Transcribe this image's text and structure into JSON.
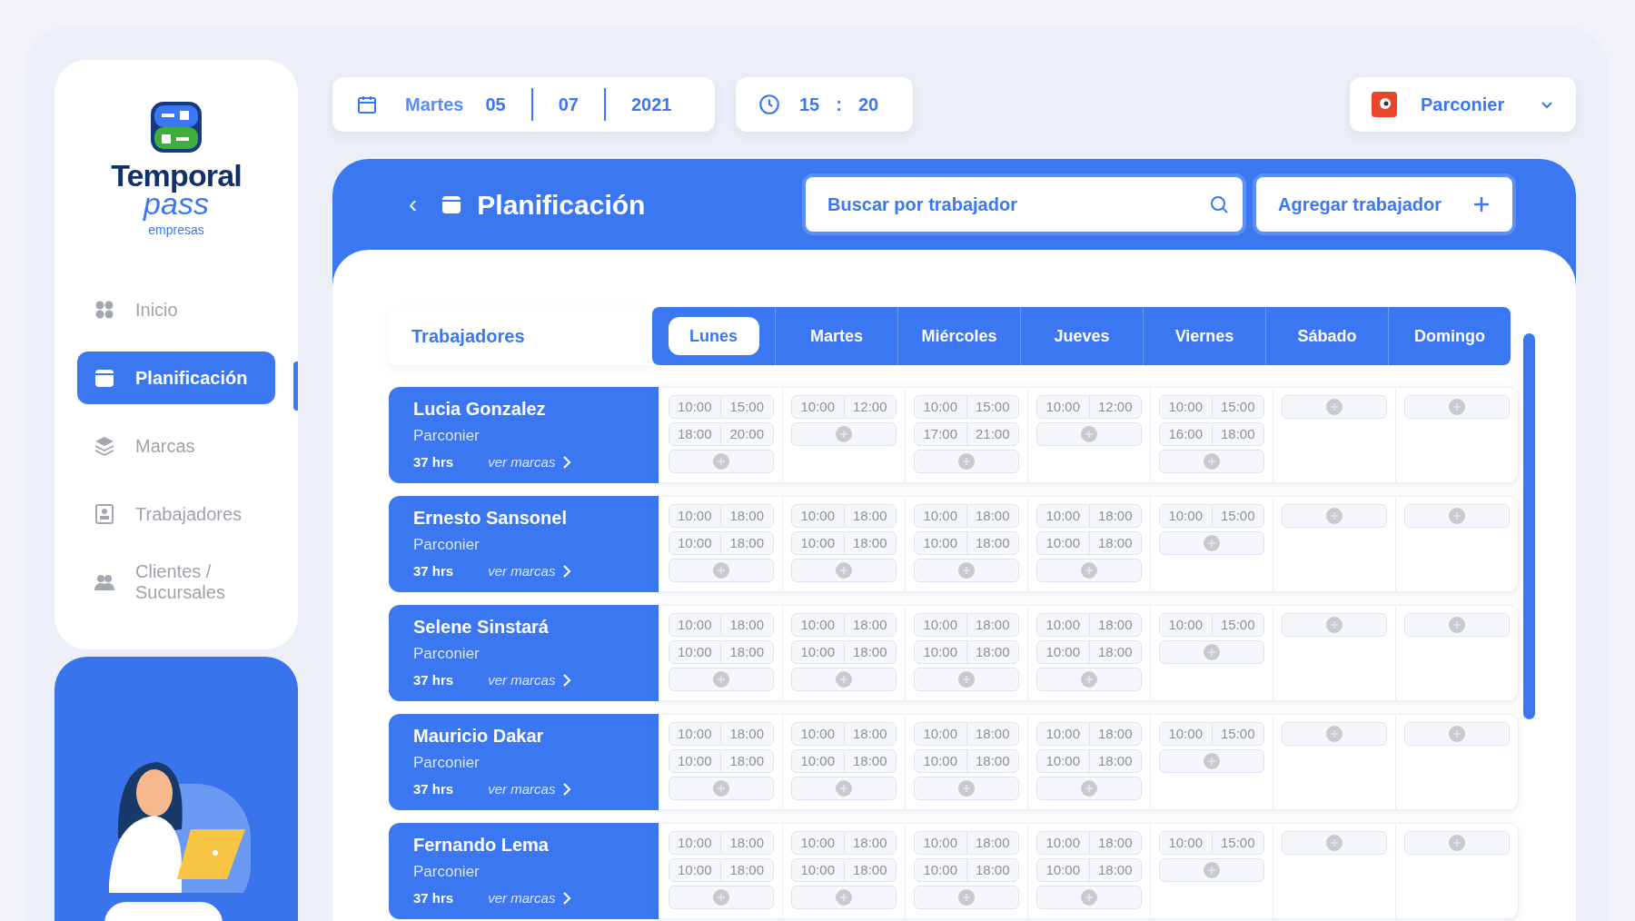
{
  "brand": {
    "name": "Temporal",
    "sub": "pass",
    "tagline": "empresas"
  },
  "sidebar": {
    "items": [
      {
        "label": "Inicio",
        "selected": false
      },
      {
        "label": "Planificación",
        "selected": true
      },
      {
        "label": "Marcas",
        "selected": false
      },
      {
        "label": "Trabajadores",
        "selected": false
      },
      {
        "label": "Clientes / Sucursales",
        "selected": false
      }
    ]
  },
  "date": {
    "weekday": "Martes",
    "day": "05",
    "month": "07",
    "year": "2021"
  },
  "time": {
    "hour": "15",
    "separator": ":",
    "minute": "20"
  },
  "user": {
    "name": "Parconier"
  },
  "header": {
    "back": "‹",
    "title": "Planificación",
    "search": {
      "placeholder": "Buscar por trabajador"
    },
    "add_button": "Agregar trabajador"
  },
  "schedule": {
    "workers_label": "Trabajadores",
    "days": [
      {
        "label": "Lunes",
        "selected": true
      },
      {
        "label": "Martes",
        "selected": false
      },
      {
        "label": "Miércoles",
        "selected": false
      },
      {
        "label": "Jueves",
        "selected": false
      },
      {
        "label": "Viernes",
        "selected": false
      },
      {
        "label": "Sábado",
        "selected": false
      },
      {
        "label": "Domingo",
        "selected": false
      }
    ],
    "rows": [
      {
        "name": "Lucia Gonzalez",
        "company": "Parconier",
        "hours": "37 hrs",
        "link": "ver marcas",
        "days": [
          [
            [
              "10:00",
              "15:00"
            ],
            [
              "18:00",
              "20:00"
            ]
          ],
          [
            [
              "10:00",
              "12:00"
            ]
          ],
          [
            [
              "10:00",
              "15:00"
            ],
            [
              "17:00",
              "21:00"
            ]
          ],
          [
            [
              "10:00",
              "12:00"
            ]
          ],
          [
            [
              "10:00",
              "15:00"
            ],
            [
              "16:00",
              "18:00"
            ]
          ]
        ]
      },
      {
        "name": "Ernesto Sansonel",
        "company": "Parconier",
        "hours": "37 hrs",
        "link": "ver marcas",
        "days": [
          [
            [
              "10:00",
              "18:00"
            ],
            [
              "10:00",
              "18:00"
            ]
          ],
          [
            [
              "10:00",
              "18:00"
            ],
            [
              "10:00",
              "18:00"
            ]
          ],
          [
            [
              "10:00",
              "18:00"
            ],
            [
              "10:00",
              "18:00"
            ]
          ],
          [
            [
              "10:00",
              "18:00"
            ],
            [
              "10:00",
              "18:00"
            ]
          ],
          [
            [
              "10:00",
              "15:00"
            ]
          ]
        ]
      },
      {
        "name": "Selene Sinstará",
        "company": "Parconier",
        "hours": "37 hrs",
        "link": "ver marcas",
        "days": [
          [
            [
              "10:00",
              "18:00"
            ],
            [
              "10:00",
              "18:00"
            ]
          ],
          [
            [
              "10:00",
              "18:00"
            ],
            [
              "10:00",
              "18:00"
            ]
          ],
          [
            [
              "10:00",
              "18:00"
            ],
            [
              "10:00",
              "18:00"
            ]
          ],
          [
            [
              "10:00",
              "18:00"
            ],
            [
              "10:00",
              "18:00"
            ]
          ],
          [
            [
              "10:00",
              "15:00"
            ]
          ]
        ]
      },
      {
        "name": "Mauricio Dakar",
        "company": "Parconier",
        "hours": "37 hrs",
        "link": "ver marcas",
        "days": [
          [
            [
              "10:00",
              "18:00"
            ],
            [
              "10:00",
              "18:00"
            ]
          ],
          [
            [
              "10:00",
              "18:00"
            ],
            [
              "10:00",
              "18:00"
            ]
          ],
          [
            [
              "10:00",
              "18:00"
            ],
            [
              "10:00",
              "18:00"
            ]
          ],
          [
            [
              "10:00",
              "18:00"
            ],
            [
              "10:00",
              "18:00"
            ]
          ],
          [
            [
              "10:00",
              "15:00"
            ]
          ]
        ]
      },
      {
        "name": "Fernando Lema",
        "company": "Parconier",
        "hours": "37 hrs",
        "link": "ver marcas",
        "days": [
          [
            [
              "10:00",
              "18:00"
            ],
            [
              "10:00",
              "18:00"
            ]
          ],
          [
            [
              "10:00",
              "18:00"
            ],
            [
              "10:00",
              "18:00"
            ]
          ],
          [
            [
              "10:00",
              "18:00"
            ],
            [
              "10:00",
              "18:00"
            ]
          ],
          [
            [
              "10:00",
              "18:00"
            ],
            [
              "10:00",
              "18:00"
            ]
          ],
          [
            [
              "10:00",
              "15:00"
            ]
          ]
        ]
      }
    ]
  }
}
